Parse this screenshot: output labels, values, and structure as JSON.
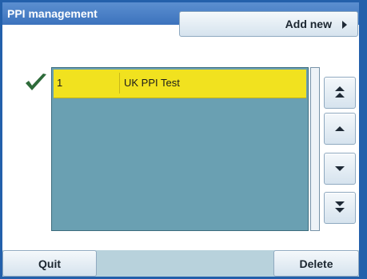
{
  "window": {
    "title": "PPI management"
  },
  "toolbar": {
    "add_new_label": "Add new",
    "add_new_icon": "triangle-right-icon"
  },
  "list": {
    "selected_index": 0,
    "rows": [
      {
        "number": "1",
        "name": "UK PPI Test",
        "selected": true
      }
    ]
  },
  "scroll_buttons": [
    {
      "name": "scroll-top-button",
      "icon": "double-up-icon"
    },
    {
      "name": "scroll-up-button",
      "icon": "up-icon"
    },
    {
      "name": "scroll-down-button",
      "icon": "down-icon"
    },
    {
      "name": "scroll-bottom-button",
      "icon": "double-down-icon"
    }
  ],
  "footer": {
    "quit_label": "Quit",
    "delete_label": "Delete"
  },
  "colors": {
    "frame": "#2360ab",
    "selected_row": "#f1e21f",
    "list_background": "#6aa0b2",
    "check": "#2e6b3a"
  }
}
